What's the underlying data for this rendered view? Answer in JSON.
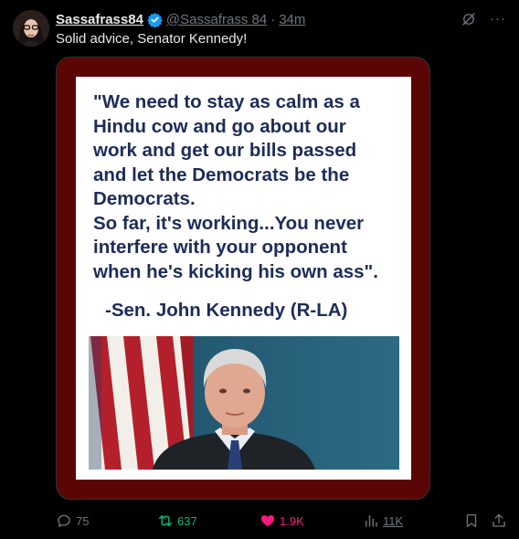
{
  "tweet": {
    "author_name": "Sassafrass84",
    "handle": "@Sassafrass 84",
    "separator": "·",
    "time": "34m",
    "text": "Solid advice, Senator Kennedy!",
    "more_label": "···"
  },
  "image": {
    "quote_lines": [
      "\"We need to stay as calm as a",
      "Hindu cow and go about our",
      "work and get our bills passed",
      "and let the Democrats be the",
      "Democrats.",
      "So far, it's working...You never",
      "interfere with your opponent",
      "when he's kicking his own ass\"."
    ],
    "attribution": "-Sen. John Kennedy (R-LA)"
  },
  "actions": {
    "replies": "75",
    "reposts": "637",
    "likes": "1.9K",
    "views": "11K"
  },
  "colors": {
    "background": "#000000",
    "text": "#e7e9ea",
    "muted": "#71767b",
    "verified": "#1d9bf0",
    "repost_active": "#00ba7c",
    "like_active": "#f91880",
    "frame": "#5b0606",
    "quote_text": "#1c2c5a"
  },
  "icons": [
    "avatar",
    "verified-badge-icon",
    "grok-icon",
    "more-icon",
    "reply-icon",
    "repost-icon",
    "like-icon",
    "views-icon",
    "bookmark-icon",
    "share-icon",
    "flag-image",
    "portrait-image"
  ]
}
